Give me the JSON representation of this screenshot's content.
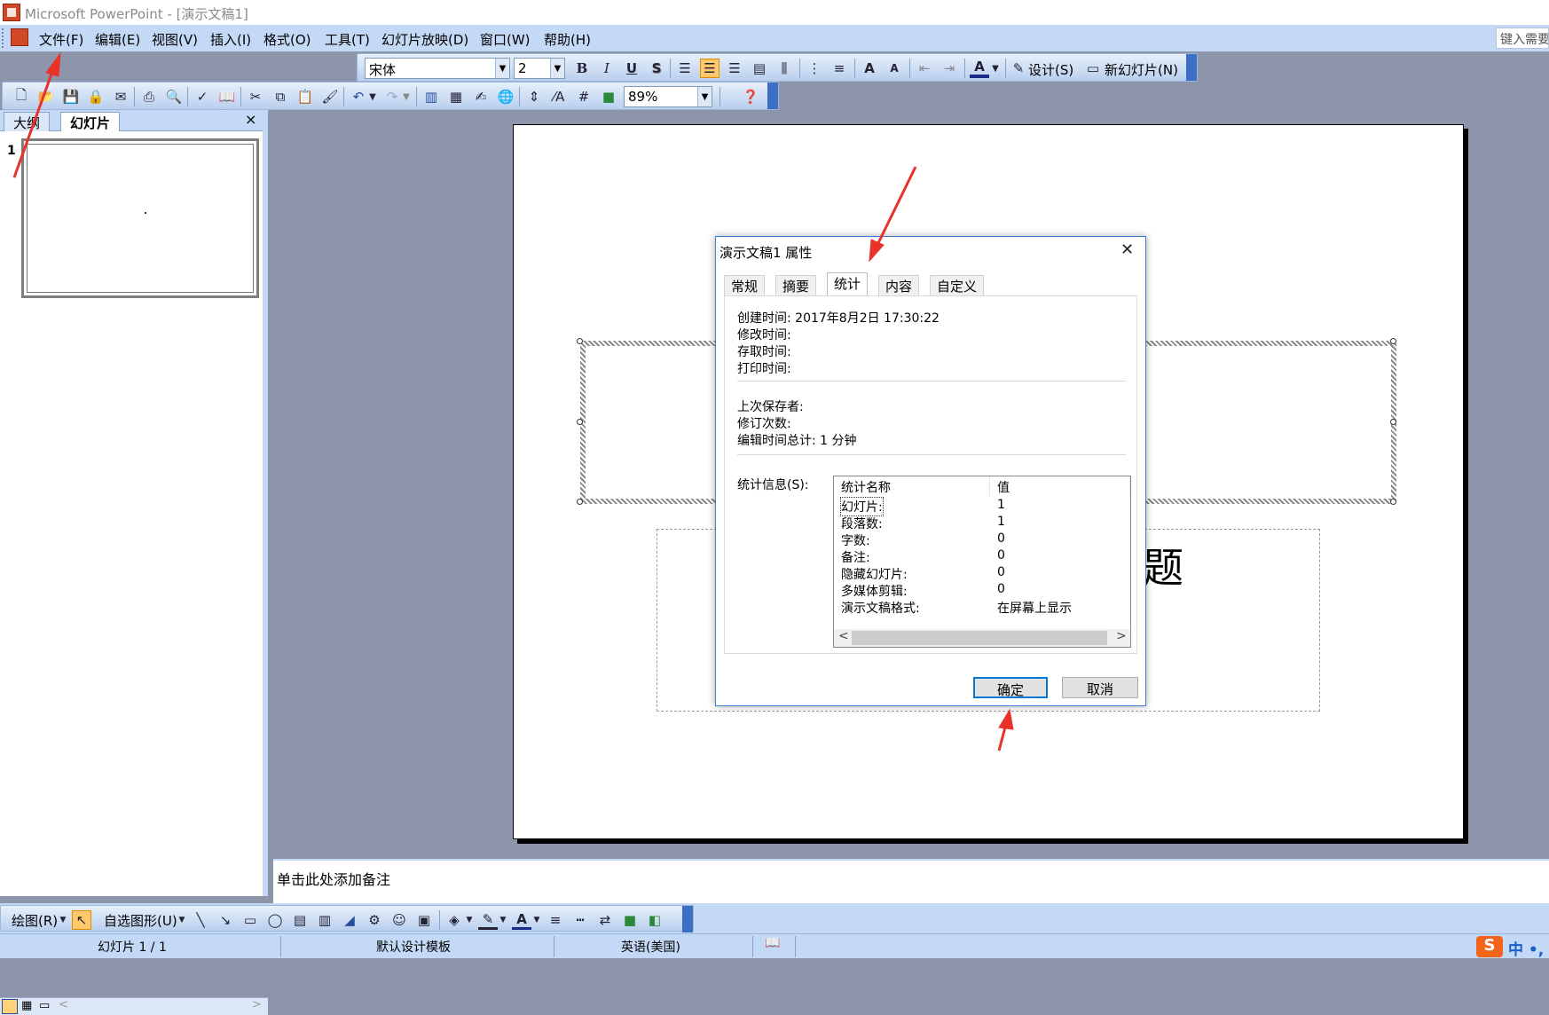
{
  "window": {
    "title": "Microsoft PowerPoint - [演示文稿1]"
  },
  "menu": {
    "items": [
      "文件(F)",
      "编辑(E)",
      "视图(V)",
      "插入(I)",
      "格式(O)",
      "工具(T)",
      "幻灯片放映(D)",
      "窗口(W)",
      "帮助(H)"
    ],
    "search_placeholder": "键入需要"
  },
  "format_toolbar": {
    "font_name": "宋体",
    "font_size": "2",
    "bold": "B",
    "italic": "I",
    "underline": "U",
    "shadow": "S",
    "design_label": "设计(S)",
    "new_slide_label": "新幻灯片(N)"
  },
  "standard_toolbar": {
    "zoom": "89%"
  },
  "left_pane": {
    "tabs": [
      "大纲",
      "幻灯片"
    ],
    "close": "×",
    "slide_number": "1"
  },
  "slide": {
    "subtitle_fragment": "题"
  },
  "notes": {
    "placeholder": "单击此处添加备注"
  },
  "drawing_toolbar": {
    "draw_label": "绘图(R)",
    "autoshape_label": "自选图形(U)"
  },
  "status": {
    "slide_info": "幻灯片 1 / 1",
    "template": "默认设计模板",
    "language": "英语(美国)",
    "ime_logo": "S",
    "ime_text": "中 •,"
  },
  "dialog": {
    "title": "演示文稿1 属性",
    "tabs": [
      "常规",
      "摘要",
      "统计",
      "内容",
      "自定义"
    ],
    "active_tab": "统计",
    "fields": {
      "created": "创建时间:  2017年8月2日 17:30:22",
      "modified": "修改时间:",
      "accessed": "存取时间:",
      "printed": "打印时间:",
      "last_saved_by": "上次保存者:",
      "revision": "修订次数:",
      "edit_time": "编辑时间总计:  1 分钟"
    },
    "stats_label": "统计信息(S):",
    "stats_columns": [
      "统计名称",
      "值"
    ],
    "stats_rows": [
      {
        "name": "幻灯片:",
        "value": "1"
      },
      {
        "name": "段落数:",
        "value": "1"
      },
      {
        "name": "字数:",
        "value": "0"
      },
      {
        "name": "备注:",
        "value": "0"
      },
      {
        "name": "隐藏幻灯片:",
        "value": "0"
      },
      {
        "name": "多媒体剪辑:",
        "value": "0"
      },
      {
        "name": "演示文稿格式:",
        "value": "在屏幕上显示"
      }
    ],
    "ok": "确定",
    "cancel": "取消"
  },
  "colors": {
    "menubar": "#c3d9f5",
    "workspace": "#8d95aa",
    "arrow": "#e8322a",
    "dialog_border": "#3c7fd6"
  }
}
